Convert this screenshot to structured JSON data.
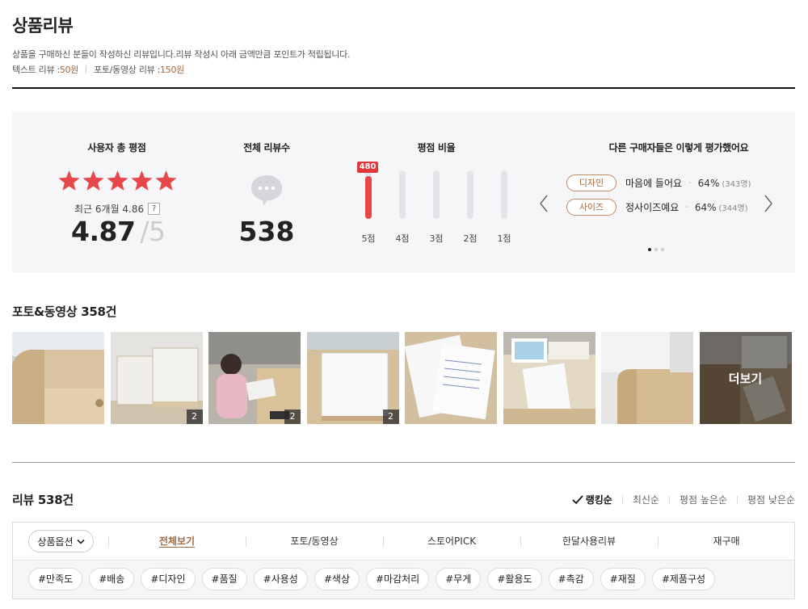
{
  "header": {
    "title": "상품리뷰",
    "description": "상품을 구매하신 분들이 작성하신 리뷰입니다.리뷰 작성시 아래 금액만큼 포인트가 적립됩니다.",
    "text_review_label": "텍스트 리뷰 : ",
    "text_review_amount": "50원",
    "photo_review_label": "포토/동영상 리뷰 : ",
    "photo_review_amount": "150원"
  },
  "summary": {
    "rating_heading": "사용자 총 평점",
    "stars": 5,
    "recent_label": "최근 6개월 4.86",
    "help_icon_text": "?",
    "score": "4.87",
    "slash": "/",
    "score_max": "5",
    "count_heading": "전체 리뷰수",
    "total_reviews": "538",
    "ratio_heading": "평점 비율",
    "bars": [
      {
        "label": "5점",
        "fill": 0.89,
        "badge": "480"
      },
      {
        "label": "4점",
        "fill": 0
      },
      {
        "label": "3점",
        "fill": 0
      },
      {
        "label": "2점",
        "fill": 0
      },
      {
        "label": "1점",
        "fill": 0
      }
    ],
    "others_heading": "다른 구매자들은 이렇게 평가했어요",
    "evaluations": [
      {
        "tag": "디자인",
        "text": "마음에 들어요",
        "dash": "-",
        "pct": "64%",
        "count": "(343명)"
      },
      {
        "tag": "사이즈",
        "text": "정사이즈예요",
        "dash": "-",
        "pct": "64%",
        "count": "(344명)"
      }
    ],
    "page_dots": 3,
    "active_dot": 0
  },
  "photos": {
    "title": "포토&동영상 358건",
    "items": [
      {
        "scene": "desk-side",
        "count": ""
      },
      {
        "scene": "boards",
        "count": "2"
      },
      {
        "scene": "child",
        "count": "2"
      },
      {
        "scene": "white-board",
        "count": "2"
      },
      {
        "scene": "papers",
        "count": ""
      },
      {
        "scene": "drawing",
        "count": ""
      },
      {
        "scene": "corner",
        "count": ""
      },
      {
        "scene": "more",
        "count": "",
        "more_label": "더보기"
      }
    ]
  },
  "reviews": {
    "title": "리뷰 538건",
    "sorts": [
      {
        "label": "랭킹순",
        "active": true
      },
      {
        "label": "최신순",
        "active": false
      },
      {
        "label": "평점 높은순",
        "active": false
      },
      {
        "label": "평점 낮은순",
        "active": false
      }
    ],
    "option_button": "상품옵션",
    "tabs": [
      {
        "label": "전체보기",
        "active": true
      },
      {
        "label": "포토/동영상",
        "active": false
      },
      {
        "label": "스토어PICK",
        "active": false
      },
      {
        "label": "한달사용리뷰",
        "active": false
      },
      {
        "label": "재구매",
        "active": false
      }
    ],
    "hashtags": [
      "#만족도",
      "#배송",
      "#디자인",
      "#품질",
      "#사용성",
      "#색상",
      "#마감처리",
      "#무게",
      "#활용도",
      "#촉감",
      "#재질",
      "#제품구성"
    ]
  },
  "colors": {
    "accent": "#a3683f",
    "star": "#e8474a",
    "bar": "#e8474a",
    "panel_bg": "#f6f6f8"
  }
}
